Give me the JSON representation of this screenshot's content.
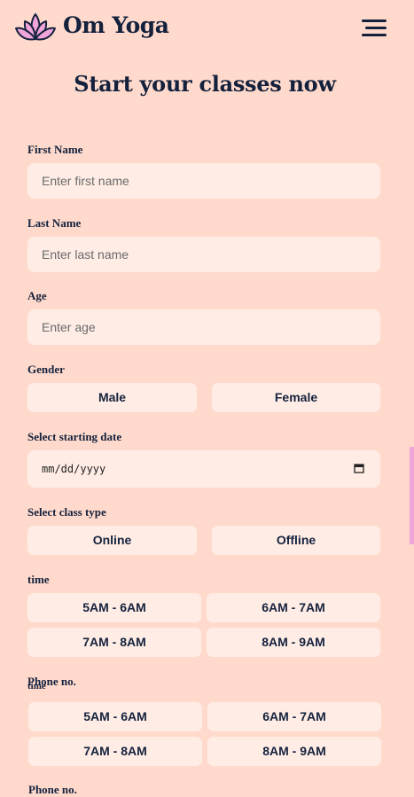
{
  "brand": {
    "name": "Om Yoga"
  },
  "title": "Start your classes now",
  "form": {
    "first_name": {
      "label": "First Name",
      "placeholder": "Enter first name"
    },
    "last_name": {
      "label": "Last Name",
      "placeholder": "Enter last name"
    },
    "age": {
      "label": "Age",
      "placeholder": "Enter age"
    },
    "gender": {
      "label": "Gender",
      "options": [
        "Male",
        "Female"
      ]
    },
    "start_date": {
      "label": "Select starting date",
      "value": "mm/dd/yyyy"
    },
    "class_type": {
      "label": "Select class type",
      "options": [
        "Online",
        "Offline"
      ]
    },
    "time": {
      "label": "time",
      "slots": [
        "5AM - 6AM",
        "6AM - 7AM",
        "7AM - 8AM",
        "8AM - 9AM"
      ]
    },
    "phone": {
      "label": "Phone no."
    },
    "time_dup": {
      "label": "time",
      "slots": [
        "5AM - 6AM",
        "6AM - 7AM",
        "7AM - 8AM",
        "8AM - 9AM"
      ]
    },
    "phone_dup": {
      "label": "Phone no."
    }
  },
  "icons": {
    "logo": "lotus-icon",
    "menu": "hamburger-menu-icon",
    "calendar": "calendar-icon"
  },
  "colors": {
    "background": "#FFDACC",
    "field": "#FFEDE5",
    "text": "#14213D",
    "accent": "#F0A5D8",
    "logo_fill": "#F0A5D8"
  }
}
